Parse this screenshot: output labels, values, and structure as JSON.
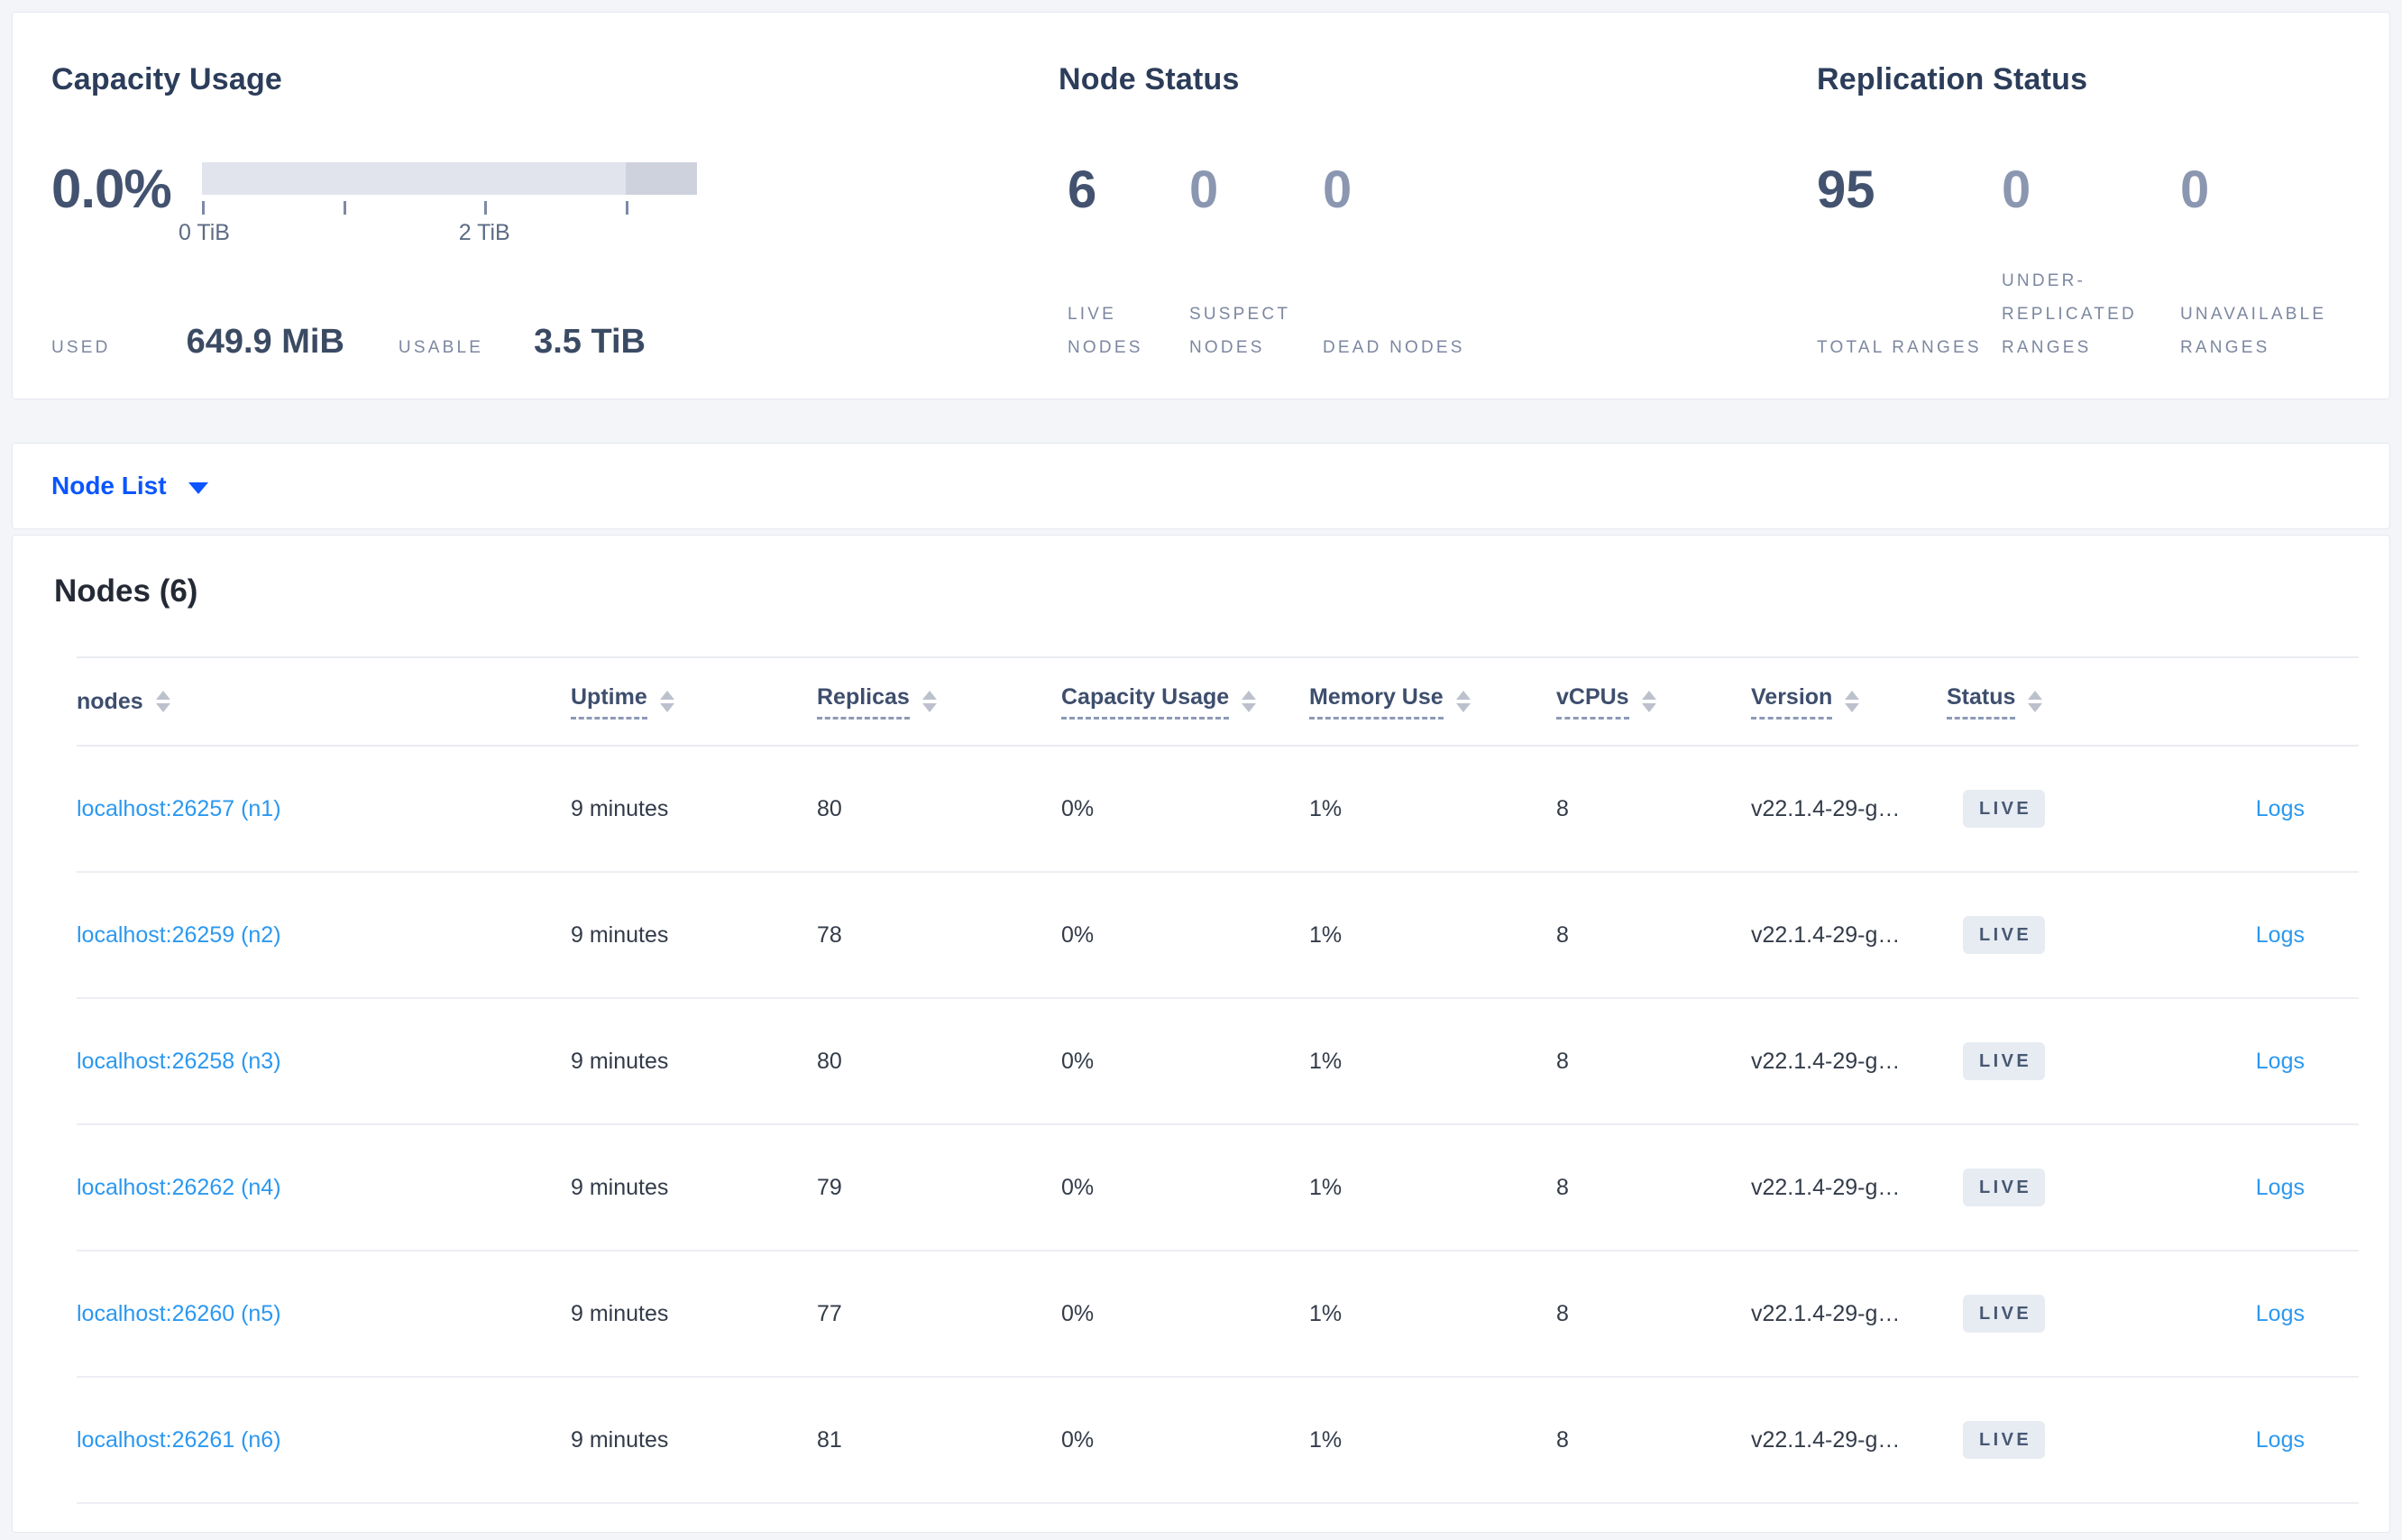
{
  "summary": {
    "capacity": {
      "title": "Capacity Usage",
      "percent": "0.0%",
      "ticks": [
        "0 TiB",
        "2 TiB"
      ],
      "used_label": "USED",
      "used_value": "649.9 MiB",
      "usable_label": "USABLE",
      "usable_value": "3.5 TiB"
    },
    "node_status": {
      "title": "Node Status",
      "metrics": [
        {
          "value": "6",
          "label": "LIVE NODES"
        },
        {
          "value": "0",
          "label": "SUSPECT NODES"
        },
        {
          "value": "0",
          "label": "DEAD NODES"
        }
      ]
    },
    "replication_status": {
      "title": "Replication Status",
      "metrics": [
        {
          "value": "95",
          "label": "TOTAL RANGES"
        },
        {
          "value": "0",
          "label": "UNDER-REPLICATED RANGES"
        },
        {
          "value": "0",
          "label": "UNAVAILABLE RANGES"
        }
      ]
    }
  },
  "node_list": {
    "label": "Node List"
  },
  "nodes": {
    "title": "Nodes (6)",
    "columns": {
      "nodes": "nodes",
      "uptime": "Uptime",
      "replicas": "Replicas",
      "capacity": "Capacity Usage",
      "memory": "Memory Use",
      "vcpus": "vCPUs",
      "version": "Version",
      "status": "Status"
    },
    "logs_label": "Logs",
    "rows": [
      {
        "address": "localhost:26257 (n1)",
        "uptime": "9 minutes",
        "replicas": "80",
        "capacity": "0%",
        "memory": "1%",
        "vcpus": "8",
        "version": "v22.1.4-29-g…",
        "status": "LIVE"
      },
      {
        "address": "localhost:26259 (n2)",
        "uptime": "9 minutes",
        "replicas": "78",
        "capacity": "0%",
        "memory": "1%",
        "vcpus": "8",
        "version": "v22.1.4-29-g…",
        "status": "LIVE"
      },
      {
        "address": "localhost:26258 (n3)",
        "uptime": "9 minutes",
        "replicas": "80",
        "capacity": "0%",
        "memory": "1%",
        "vcpus": "8",
        "version": "v22.1.4-29-g…",
        "status": "LIVE"
      },
      {
        "address": "localhost:26262 (n4)",
        "uptime": "9 minutes",
        "replicas": "79",
        "capacity": "0%",
        "memory": "1%",
        "vcpus": "8",
        "version": "v22.1.4-29-g…",
        "status": "LIVE"
      },
      {
        "address": "localhost:26260 (n5)",
        "uptime": "9 minutes",
        "replicas": "77",
        "capacity": "0%",
        "memory": "1%",
        "vcpus": "8",
        "version": "v22.1.4-29-g…",
        "status": "LIVE"
      },
      {
        "address": "localhost:26261 (n6)",
        "uptime": "9 minutes",
        "replicas": "81",
        "capacity": "0%",
        "memory": "1%",
        "vcpus": "8",
        "version": "v22.1.4-29-g…",
        "status": "LIVE"
      }
    ]
  },
  "colors": {
    "page_background": "#f4f5f9",
    "primary_blue": "#0b55ff",
    "link_blue": "#2b98f0",
    "badge_background": "#e7ebf2",
    "badge_text": "#475872",
    "bar_light": "#e2e4ed",
    "bar_dark": "#ced2dd",
    "metric_emphasis": "#42526f",
    "metric_dim": "#8b97b1"
  }
}
